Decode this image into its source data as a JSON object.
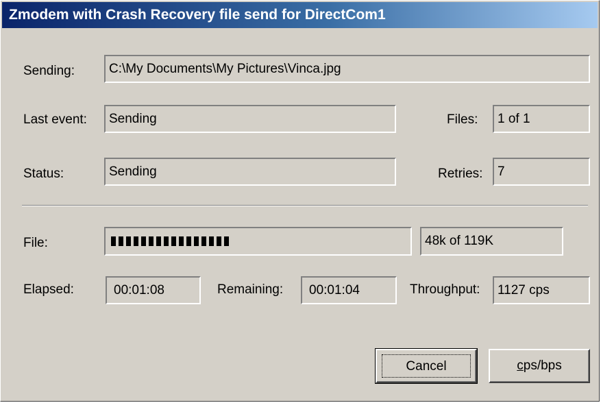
{
  "window": {
    "title": "Zmodem with Crash Recovery file send for DirectCom1"
  },
  "sending": {
    "label": "Sending:",
    "value": "C:\\My Documents\\My Pictures\\Vinca.jpg"
  },
  "last_event": {
    "label": "Last event:",
    "value": "Sending"
  },
  "files": {
    "label": "Files:",
    "value": "1 of 1"
  },
  "status": {
    "label": "Status:",
    "value": "Sending"
  },
  "retries": {
    "label": "Retries:",
    "value": "7"
  },
  "file_progress": {
    "label": "File:",
    "size_text": "48k of 119K",
    "fraction": 0.403
  },
  "elapsed": {
    "label": "Elapsed:",
    "value": "00:01:08"
  },
  "remaining": {
    "label": "Remaining:",
    "value": "00:01:04"
  },
  "throughput": {
    "label": "Throughput:",
    "value": "1127 cps"
  },
  "buttons": {
    "cancel_label": "Cancel",
    "cpsbps_mnemonic": "c",
    "cpsbps_rest": "ps/bps"
  },
  "colors": {
    "title_gradient_start": "#0a246a",
    "title_gradient_end": "#a6caf0",
    "dialog_face": "#d4d0c8"
  }
}
